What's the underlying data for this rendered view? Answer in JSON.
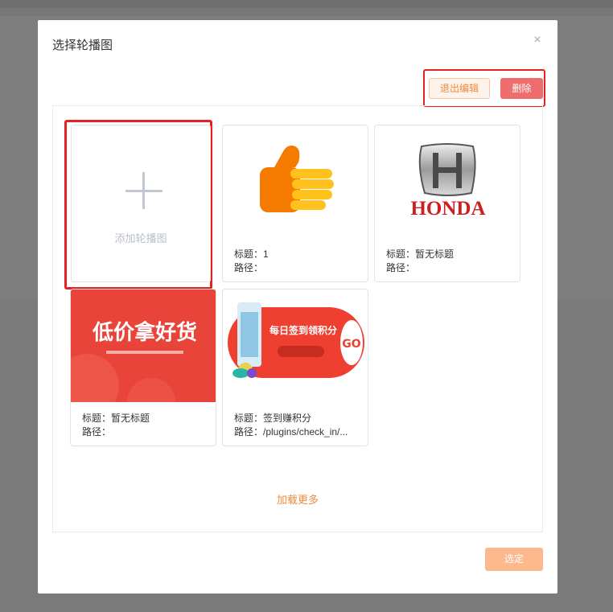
{
  "dialog": {
    "title": "选择轮播图",
    "close_symbol": "×"
  },
  "toolbar": {
    "exit_edit_label": "退出编辑",
    "delete_label": "删除"
  },
  "add_card": {
    "label": "添加轮播图"
  },
  "cards": [
    {
      "image": "thumbs-up",
      "title_line": "标题：1",
      "path_line": "路径："
    },
    {
      "image": "honda-logo",
      "logo_text": "HONDA",
      "title_line": "标题：暂无标题",
      "path_line": "路径："
    },
    {
      "image": "low-price-banner",
      "banner_text": "低价拿好货",
      "title_line": "标题：暂无标题",
      "path_line": "路径："
    },
    {
      "image": "checkin-banner",
      "banner_text": "每日签到领积分",
      "badge_text": "GO",
      "title_line": "标题：签到赚积分",
      "path_line": "路径：/plugins/check_in/..."
    }
  ],
  "load_more_label": "加载更多",
  "confirm_label": "选定",
  "colors": {
    "accent": "#f08a3c",
    "delete": "#f06d6d",
    "confirm": "#fcb98e",
    "highlight": "#e52222"
  }
}
